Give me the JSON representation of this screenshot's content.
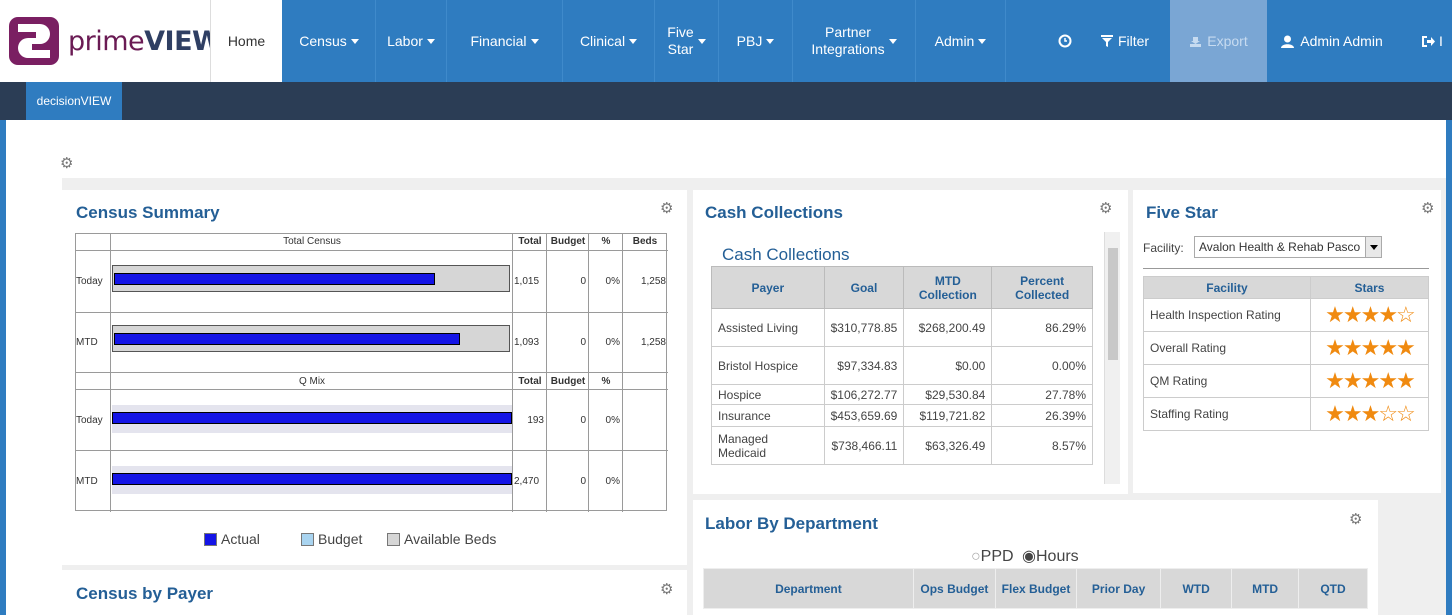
{
  "brand": {
    "name_prefix": "prime",
    "name_suffix": "VIEW"
  },
  "nav": {
    "home": "Home",
    "items": [
      {
        "label": "Census",
        "dropdown": true
      },
      {
        "label": "Labor",
        "dropdown": true
      },
      {
        "label": "Financial",
        "dropdown": true
      },
      {
        "label": "Clinical",
        "dropdown": true
      },
      {
        "label": "Five Star",
        "line1": "Five",
        "line2": "Star",
        "dropdown": true
      },
      {
        "label": "PBJ",
        "dropdown": true
      },
      {
        "label": "Partner Integrations",
        "line1": "Partner",
        "line2": "Integrations",
        "dropdown": true
      },
      {
        "label": "Admin",
        "dropdown": true
      }
    ],
    "clock_icon": "clock-icon",
    "filter": "Filter",
    "export": "Export",
    "user": "Admin Admin",
    "logout_glyph": "I"
  },
  "subnav": {
    "tab": "decisionVIEW"
  },
  "census_summary": {
    "title": "Census Summary",
    "section1": {
      "header": "Total Census",
      "cols": [
        "Total",
        "Budget",
        "%",
        "Beds"
      ],
      "rows": [
        {
          "label": "Today",
          "total": "1,015",
          "budget": "0",
          "pct": "0%",
          "beds": "1,258"
        },
        {
          "label": "MTD",
          "total": "1,093",
          "budget": "0",
          "pct": "0%",
          "beds": "1,258"
        }
      ]
    },
    "section2": {
      "header": "Q Mix",
      "cols": [
        "Total",
        "Budget",
        "%"
      ],
      "rows": [
        {
          "label": "Today",
          "total": "193",
          "budget": "0",
          "pct": "0%"
        },
        {
          "label": "MTD",
          "total": "2,470",
          "budget": "0",
          "pct": "0%"
        }
      ]
    },
    "legend": [
      "Actual",
      "Budget",
      "Available Beds"
    ],
    "legend_colors": [
      "#1414e6",
      "#a9d4f0",
      "#d6d6d6"
    ]
  },
  "cash_collections": {
    "title": "Cash Collections",
    "subtitle": "Cash Collections",
    "columns": [
      "Payer",
      "Goal",
      "MTD Collection",
      "Percent Collected"
    ],
    "rows": [
      [
        "Assisted Living",
        "$310,778.85",
        "$268,200.49",
        "86.29%"
      ],
      [
        "Bristol Hospice",
        "$97,334.83",
        "$0.00",
        "0.00%"
      ],
      [
        "Hospice",
        "$106,272.77",
        "$29,530.84",
        "27.78%"
      ],
      [
        "Insurance",
        "$453,659.69",
        "$119,721.82",
        "26.39%"
      ],
      [
        "Managed Medicaid",
        "$738,466.11",
        "$63,326.49",
        "8.57%"
      ]
    ]
  },
  "five_star": {
    "title": "Five Star",
    "facility_label": "Facility:",
    "facility_value": "Avalon Health & Rehab Pasco",
    "columns": [
      "Facility",
      "Stars"
    ],
    "rows": [
      {
        "name": "Health Inspection Rating",
        "stars": 4
      },
      {
        "name": "Overall Rating",
        "stars": 5
      },
      {
        "name": "QM Rating",
        "stars": 5
      },
      {
        "name": "Staffing Rating",
        "stars": 3
      }
    ]
  },
  "labor": {
    "title": "Labor By Department",
    "options": [
      "PPD",
      "Hours"
    ],
    "selected": "Hours",
    "columns": [
      "Department",
      "Ops Budget",
      "Flex Budget",
      "Prior Day",
      "WTD",
      "MTD",
      "QTD"
    ]
  },
  "census_by_payer": {
    "title": "Census by Payer"
  }
}
